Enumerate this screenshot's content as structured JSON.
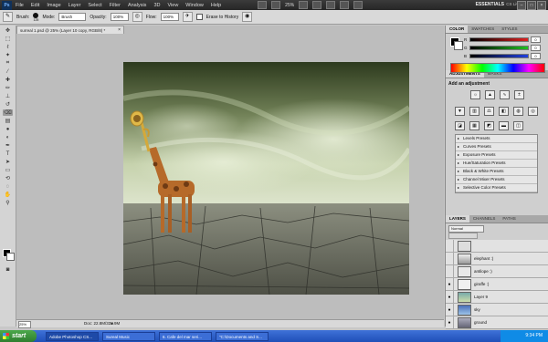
{
  "menubar": {
    "logo": "Ps",
    "items": [
      "File",
      "Edit",
      "Image",
      "Layer",
      "Select",
      "Filter",
      "Analysis",
      "3D",
      "View",
      "Window",
      "Help"
    ],
    "zoom": "25%",
    "workspace": "ESSENTIALS",
    "cs_live": "CS Live"
  },
  "options": {
    "brush_label": "Brush:",
    "brush_size": "125",
    "mode_label": "Mode:",
    "mode_value": "Brush",
    "opacity_label": "Opacity:",
    "opacity_value": "100%",
    "flow_label": "Flow:",
    "flow_value": "100%",
    "erase_history_label": "Erase to History"
  },
  "document": {
    "tab_title": "surreal 1.psd @ 25% (Layer 10 copy, RGB/8) *",
    "status_zoom": "25%",
    "status_doc": "Doc: 22.8M/338.9M"
  },
  "color_panel": {
    "tabs": [
      "COLOR",
      "SWATCHES",
      "STYLES"
    ],
    "channels": [
      {
        "name": "R",
        "value": "0",
        "color": "#e02020"
      },
      {
        "name": "G",
        "value": "0",
        "color": "#20c020"
      },
      {
        "name": "B",
        "value": "0",
        "color": "#2040e0"
      }
    ]
  },
  "adjustments_panel": {
    "tabs": [
      "ADJUSTMENTS",
      "MASKS"
    ],
    "heading": "Add an adjustment",
    "presets": [
      "Levels Presets",
      "Curves Presets",
      "Exposure Presets",
      "Hue/Saturation Presets",
      "Black & White Presets",
      "Channel Mixer Presets",
      "Selective Color Presets"
    ]
  },
  "layers_panel": {
    "tabs": [
      "LAYERS",
      "CHANNELS",
      "PATHS"
    ],
    "blend_mode": "Normal",
    "layers": [
      {
        "name": "",
        "visible": false
      },
      {
        "name": "elephant :)",
        "visible": false
      },
      {
        "name": "antilope :)",
        "visible": false
      },
      {
        "name": "giraffe :)",
        "visible": true
      },
      {
        "name": "Layer 9",
        "visible": true
      },
      {
        "name": "sky",
        "visible": true
      },
      {
        "name": "ground",
        "visible": true
      }
    ]
  },
  "taskbar": {
    "start": "start",
    "tasks": [
      {
        "label": "Adobe Photoshop CS...",
        "active": true
      },
      {
        "label": "Sureal Music",
        "active": false
      },
      {
        "label": "6. Cafe del mar seri...",
        "active": false
      },
      {
        "label": "\"C:\\Documents and S...",
        "active": false
      }
    ],
    "clock": "9:34 PM"
  }
}
